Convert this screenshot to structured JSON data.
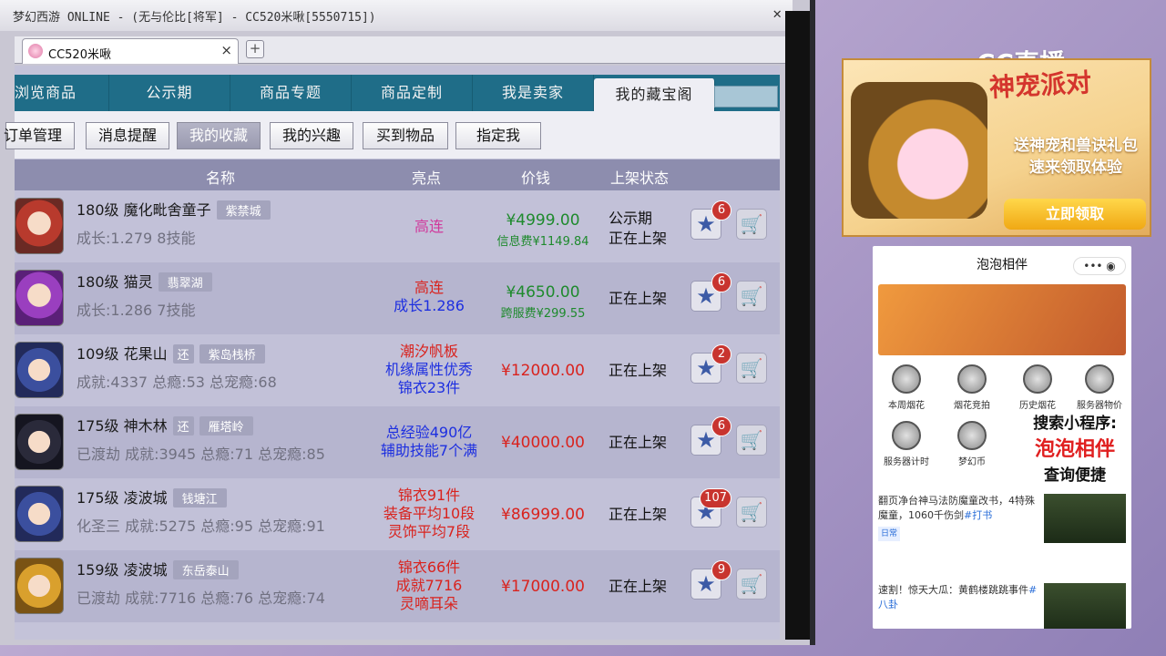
{
  "window_title": "梦幻西游 ONLINE - (无与伦比[将军] - CC520米啾[5550715])",
  "browser_tab": {
    "label": "CC520米啾",
    "close": "×",
    "new_tab": "+"
  },
  "nav_tabs": [
    "浏览商品",
    "公示期",
    "商品专题",
    "商品定制",
    "我是卖家",
    "我的藏宝阁"
  ],
  "sub_buttons": [
    "订单管理",
    "消息提醒",
    "我的收藏",
    "我的兴趣",
    "买到物品",
    "指定我"
  ],
  "table_headers": {
    "name": "名称",
    "feature": "亮点",
    "price": "价钱",
    "status": "上架状态"
  },
  "rows": [
    {
      "name": "180级 魔化毗舍童子",
      "badge": "紫禁城",
      "detail": "成长:1.279 8技能",
      "feature": [
        "高连"
      ],
      "feature_color": "pink",
      "price": "¥4999.00",
      "price_color": "green",
      "price_sub": "信息费¥1149.84",
      "status": [
        "公示期",
        "正在上架"
      ],
      "fav_count": "6"
    },
    {
      "name": "180级 猫灵",
      "badge": "翡翠湖",
      "detail": "成长:1.286 7技能",
      "feature": [
        "高连",
        "成长1.286"
      ],
      "feature_color": "mixed",
      "price": "¥4650.00",
      "price_color": "green",
      "price_sub": "跨服费¥299.55",
      "status": [
        "正在上架"
      ],
      "fav_count": "6"
    },
    {
      "name": "109级 花果山",
      "huan": "还",
      "badge": "紫岛栈桥",
      "detail": "成就:4337 总瘾:53 总宠瘾:68",
      "feature": [
        "潮汐帆板",
        "机缘属性优秀",
        "锦衣23件"
      ],
      "feature_color": "mixed3",
      "price": "¥12000.00",
      "price_color": "red",
      "price_sub": "",
      "status": [
        "正在上架"
      ],
      "fav_count": "2"
    },
    {
      "name": "175级 神木林",
      "huan": "还",
      "badge": "雁塔岭",
      "detail": "已渡劫 成就:3945 总瘾:71 总宠瘾:85",
      "feature": [
        "总经验490亿",
        "辅助技能7个满"
      ],
      "feature_color": "blue",
      "price": "¥40000.00",
      "price_color": "red",
      "price_sub": "",
      "status": [
        "正在上架"
      ],
      "fav_count": "6"
    },
    {
      "name": "175级 凌波城",
      "badge": "钱塘江",
      "detail": "化圣三 成就:5275 总瘾:95 总宠瘾:91",
      "feature": [
        "锦衣91件",
        "装备平均10段",
        "灵饰平均7段"
      ],
      "feature_color": "red",
      "price": "¥86999.00",
      "price_color": "red",
      "price_sub": "",
      "status": [
        "正在上架"
      ],
      "fav_count": "107"
    },
    {
      "name": "159级 凌波城",
      "badge": "东岳泰山",
      "detail": "已渡劫 成就:7716 总瘾:76 总宠瘾:74",
      "feature": [
        "锦衣66件",
        "成就7716",
        "灵嘀耳朵"
      ],
      "feature_color": "red",
      "price": "¥17000.00",
      "price_color": "red",
      "price_sub": "",
      "status": [
        "正在上架"
      ],
      "fav_count": "9"
    }
  ],
  "stream_logo": "CC直播",
  "promo": {
    "title": "神宠派对",
    "line1": "送神宠和兽诀礼包",
    "line2": "速来领取体验",
    "button": "立即领取"
  },
  "phone": {
    "title": "泡泡相伴",
    "menu": "•••  ◉",
    "grid": [
      "本周烟花",
      "烟花竞拍",
      "历史烟花",
      "服务器物价",
      "服务器计时",
      "梦幻币"
    ],
    "callout": [
      "搜索小程序:",
      "泡泡相伴",
      "查询便捷"
    ],
    "news": [
      {
        "text": "翻页净台神马法防魔童改书，4特殊魔童，1060千伤剑",
        "hash": "#打书",
        "tag": "日常"
      },
      {
        "text": "速割！惊天大瓜：黄鹤楼跳跳事件",
        "hash": "#八卦",
        "tag": ""
      }
    ]
  },
  "colors": {
    "nav": "#1f6d88",
    "header": "#8d8dae",
    "green": "#1e8a2d",
    "red": "#d9231e",
    "blue": "#1d2fe0",
    "fav_badge": "#c8342f"
  }
}
